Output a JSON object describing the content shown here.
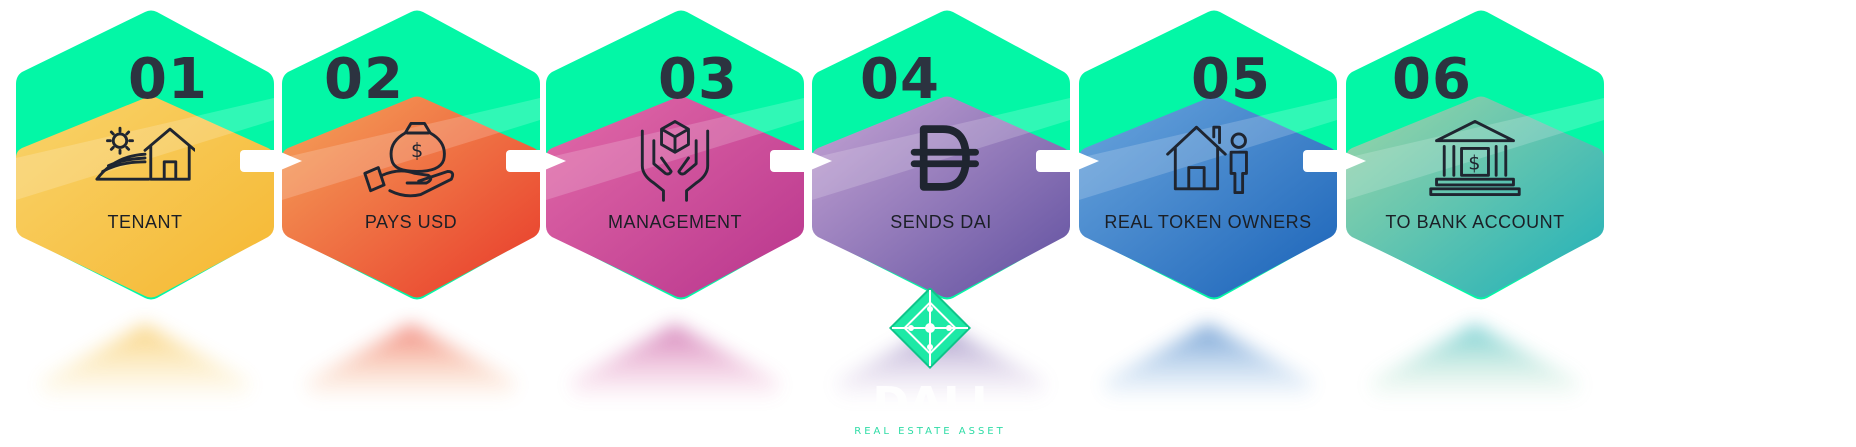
{
  "steps": [
    {
      "number": "01",
      "label": "TENANT",
      "icon": "house-farm-icon",
      "colors": [
        "#f9d36a",
        "#f5b731"
      ]
    },
    {
      "number": "02",
      "label": "PAYS USD",
      "icon": "money-hand-icon",
      "colors": [
        "#f5a35a",
        "#e8392a"
      ]
    },
    {
      "number": "03",
      "label": "MANAGEMENT",
      "icon": "box-hands-icon",
      "colors": [
        "#e26aa8",
        "#b8358d"
      ]
    },
    {
      "number": "04",
      "label": "SENDS DAI",
      "icon": "dai-icon",
      "colors": [
        "#c5a4d4",
        "#5f4f9f"
      ]
    },
    {
      "number": "05",
      "label": "REAL TOKEN OWNERS",
      "icon": "house-person-icon",
      "colors": [
        "#6aa5dd",
        "#1a63b8"
      ]
    },
    {
      "number": "06",
      "label": "TO BANK ACCOUNT",
      "icon": "bank-icon",
      "colors": [
        "#9bd6a8",
        "#1fb0b9"
      ]
    }
  ],
  "accent_color": "#03f7a6",
  "logo": {
    "icon": "diamond-logo-icon",
    "text": "DALI",
    "subtitle": "REAL ESTATE ASSET"
  }
}
